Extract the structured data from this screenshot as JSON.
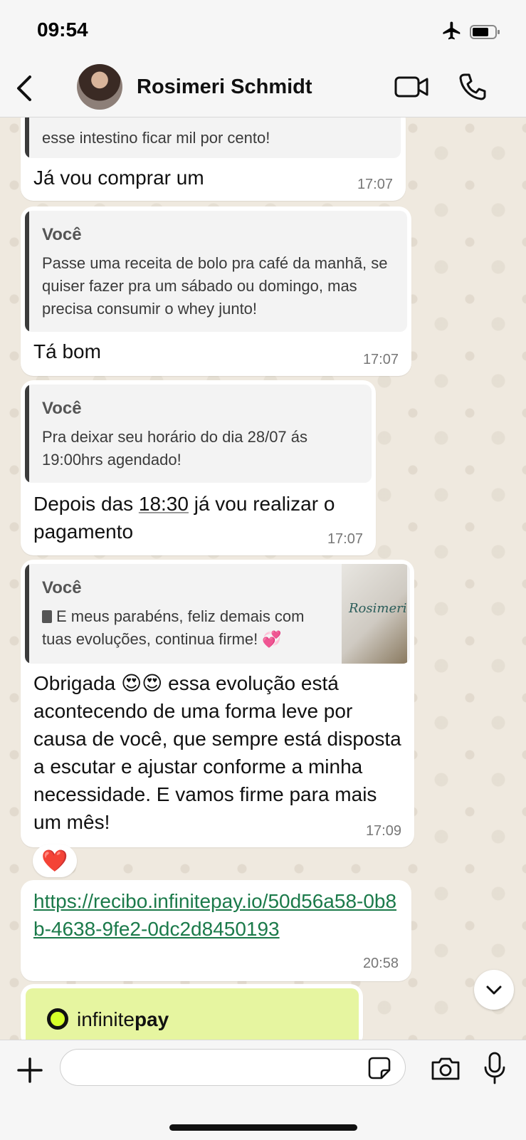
{
  "status_bar": {
    "time": "09:54"
  },
  "header": {
    "contact_name": "Rosimeri Schmidt"
  },
  "messages": [
    {
      "quote_text": "esse intestino ficar mil por cento!",
      "text": "Já vou comprar um",
      "time": "17:07"
    },
    {
      "quote_author": "Você",
      "quote_text": "Passe uma receita de bolo pra café da manhã, se quiser fazer pra um sábado ou domingo, mas precisa consumir o whey junto!",
      "text": "Tá bom",
      "time": "17:07"
    },
    {
      "quote_author": "Você",
      "quote_text": "Pra deixar seu horário do dia 28/07 ás 19:00hrs agendado!",
      "text_before": "Depois das ",
      "text_time_link": "18:30",
      "text_after": " já vou realizar o pagamento",
      "time": "17:07"
    },
    {
      "quote_author": "Você",
      "quote_text": "E meus parabéns, feliz demais com tuas evoluções, continua firme! 💞",
      "thumbnail_text": "Rosimeri",
      "text": "Obrigada 😍😍 essa evolução está acontecendo de uma forma leve por causa de você, que sempre está disposta a escutar e ajustar conforme a minha necessidade. E vamos firme para mais um mês!",
      "time": "17:09",
      "reaction": "❤️"
    },
    {
      "link": "https://recibo.infinitepay.io/50d56a58-0b8b-4638-9fe2-0dc2d8450193",
      "time": "20:58"
    }
  ],
  "card": {
    "brand_light": "infinite",
    "brand_bold": "pay"
  },
  "composer": {
    "placeholder": ""
  },
  "colors": {
    "link": "#1b7a4a",
    "quote_bar": "#3b3b3b",
    "card_bg": "#e6f5a0"
  }
}
